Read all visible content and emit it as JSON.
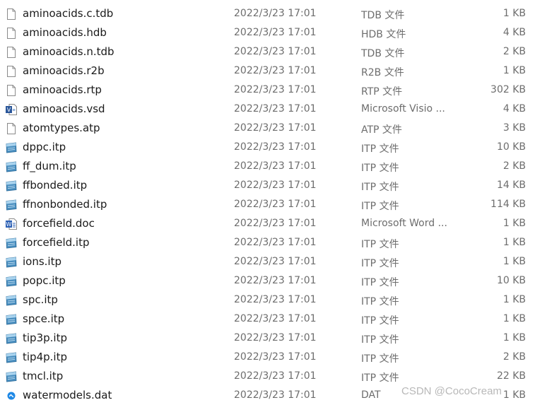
{
  "files": [
    {
      "name": "aminoacids.c.tdb",
      "date": "2022/3/23 17:01",
      "type": "TDB 文件",
      "size": "1 KB",
      "icon": "blank-file-icon"
    },
    {
      "name": "aminoacids.hdb",
      "date": "2022/3/23 17:01",
      "type": "HDB 文件",
      "size": "4 KB",
      "icon": "blank-file-icon"
    },
    {
      "name": "aminoacids.n.tdb",
      "date": "2022/3/23 17:01",
      "type": "TDB 文件",
      "size": "2 KB",
      "icon": "blank-file-icon"
    },
    {
      "name": "aminoacids.r2b",
      "date": "2022/3/23 17:01",
      "type": "R2B 文件",
      "size": "1 KB",
      "icon": "blank-file-icon"
    },
    {
      "name": "aminoacids.rtp",
      "date": "2022/3/23 17:01",
      "type": "RTP 文件",
      "size": "302 KB",
      "icon": "blank-file-icon"
    },
    {
      "name": "aminoacids.vsd",
      "date": "2022/3/23 17:01",
      "type": "Microsoft Visio ...",
      "size": "4 KB",
      "icon": "visio-file-icon"
    },
    {
      "name": "atomtypes.atp",
      "date": "2022/3/23 17:01",
      "type": "ATP 文件",
      "size": "3 KB",
      "icon": "blank-file-icon"
    },
    {
      "name": "dppc.itp",
      "date": "2022/3/23 17:01",
      "type": "ITP 文件",
      "size": "10 KB",
      "icon": "itp-file-icon"
    },
    {
      "name": "ff_dum.itp",
      "date": "2022/3/23 17:01",
      "type": "ITP 文件",
      "size": "2 KB",
      "icon": "itp-file-icon"
    },
    {
      "name": "ffbonded.itp",
      "date": "2022/3/23 17:01",
      "type": "ITP 文件",
      "size": "14 KB",
      "icon": "itp-file-icon"
    },
    {
      "name": "ffnonbonded.itp",
      "date": "2022/3/23 17:01",
      "type": "ITP 文件",
      "size": "114 KB",
      "icon": "itp-file-icon"
    },
    {
      "name": "forcefield.doc",
      "date": "2022/3/23 17:01",
      "type": "Microsoft Word ...",
      "size": "1 KB",
      "icon": "word-file-icon"
    },
    {
      "name": "forcefield.itp",
      "date": "2022/3/23 17:01",
      "type": "ITP 文件",
      "size": "1 KB",
      "icon": "itp-file-icon"
    },
    {
      "name": "ions.itp",
      "date": "2022/3/23 17:01",
      "type": "ITP 文件",
      "size": "1 KB",
      "icon": "itp-file-icon"
    },
    {
      "name": "popc.itp",
      "date": "2022/3/23 17:01",
      "type": "ITP 文件",
      "size": "10 KB",
      "icon": "itp-file-icon"
    },
    {
      "name": "spc.itp",
      "date": "2022/3/23 17:01",
      "type": "ITP 文件",
      "size": "1 KB",
      "icon": "itp-file-icon"
    },
    {
      "name": "spce.itp",
      "date": "2022/3/23 17:01",
      "type": "ITP 文件",
      "size": "1 KB",
      "icon": "itp-file-icon"
    },
    {
      "name": "tip3p.itp",
      "date": "2022/3/23 17:01",
      "type": "ITP 文件",
      "size": "1 KB",
      "icon": "itp-file-icon"
    },
    {
      "name": "tip4p.itp",
      "date": "2022/3/23 17:01",
      "type": "ITP 文件",
      "size": "2 KB",
      "icon": "itp-file-icon"
    },
    {
      "name": "tmcl.itp",
      "date": "2022/3/23 17:01",
      "type": "ITP 文件",
      "size": "22 KB",
      "icon": "itp-file-icon"
    },
    {
      "name": "watermodels.dat",
      "date": "2022/3/23 17:01",
      "type": "DAT",
      "size": "1 KB",
      "icon": "dat-file-icon"
    }
  ],
  "watermark": "CSDN @CocoCream",
  "colors": {
    "detail_text": "#6d6d6d",
    "name_text": "#1a1a1a",
    "hover_row": "#e5f3ff",
    "watermark": "#b8b8b8"
  }
}
